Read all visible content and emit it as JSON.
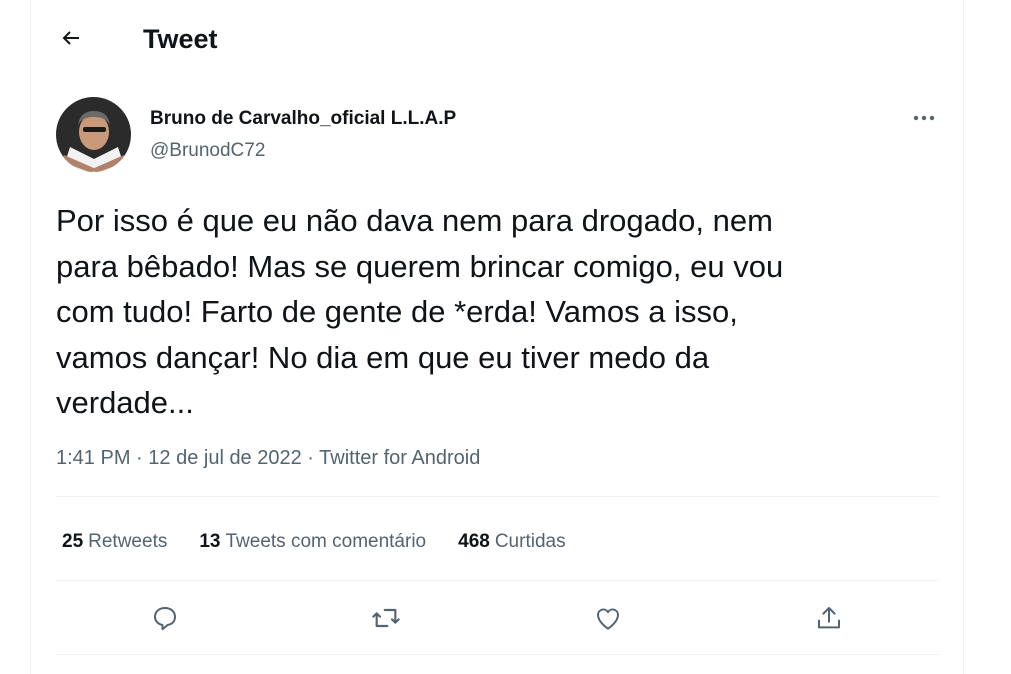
{
  "header": {
    "title": "Tweet",
    "back_icon": "arrow-left-icon"
  },
  "author": {
    "display_name": "Bruno de Carvalho_oficial L.L.A.P",
    "handle": "@BrunodC72",
    "avatar_icon": "avatar"
  },
  "tweet": {
    "text": "Por isso é que eu não dava nem para drogado, nem\npara bêbado! Mas se querem brincar comigo, eu vou\ncom tudo! Farto de gente de *erda! Vamos a isso,\nvamos dançar! No dia em que eu tiver medo da\nverdade...",
    "time": "1:41 PM",
    "date": "12 de jul de 2022",
    "source": "Twitter for Android",
    "separator": " · "
  },
  "stats": {
    "retweets_count": "25",
    "retweets_label": "Retweets",
    "quotes_count": "13",
    "quotes_label": "Tweets com comentário",
    "likes_count": "468",
    "likes_label": "Curtidas"
  },
  "actions": [
    "reply-icon",
    "retweet-icon",
    "like-icon",
    "share-icon"
  ],
  "colors": {
    "text": "#0f1419",
    "secondary": "#536471",
    "border": "#eff3f4"
  }
}
